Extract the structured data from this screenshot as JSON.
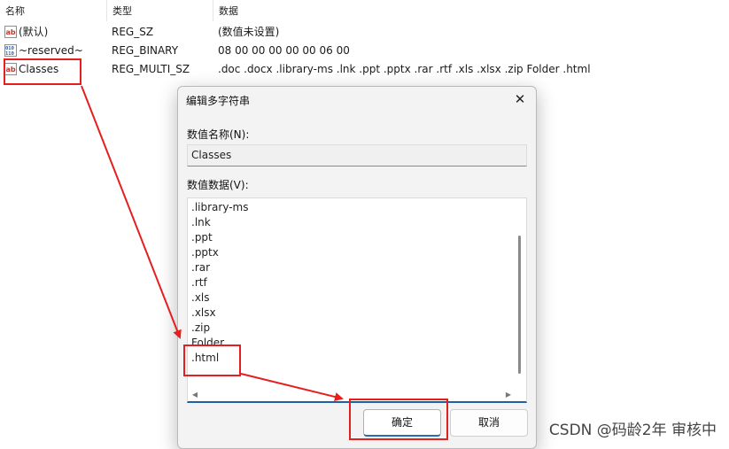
{
  "columns": {
    "name": "名称",
    "type": "类型",
    "data": "数据"
  },
  "values": [
    {
      "icon": "string-value-icon",
      "name": "(默认)",
      "type": "REG_SZ",
      "data": "(数值未设置)"
    },
    {
      "icon": "binary-value-icon",
      "name": "~reserved~",
      "type": "REG_BINARY",
      "data": "08 00 00 00 00 00 06 00"
    },
    {
      "icon": "string-value-icon",
      "name": "Classes",
      "type": "REG_MULTI_SZ",
      "data": ".doc .docx .library-ms .lnk .ppt .pptx .rar .rtf .xls .xlsx .zip Folder .html"
    }
  ],
  "dialog": {
    "title": "编辑多字符串",
    "close_symbol": "✕",
    "value_name_label": "数值名称(N):",
    "value_name": "Classes",
    "value_data_label": "数值数据(V):",
    "lines": [
      ".library-ms",
      ".lnk",
      ".ppt",
      ".pptx",
      ".rar",
      ".rtf",
      ".xls",
      ".xlsx",
      ".zip",
      "Folder",
      ".html"
    ],
    "ok_label": "确定",
    "cancel_label": "取消"
  },
  "watermark": "CSDN @码龄2年 审核中",
  "colors": {
    "annotation": "#e61e1e",
    "accent": "#1f5fa8"
  }
}
